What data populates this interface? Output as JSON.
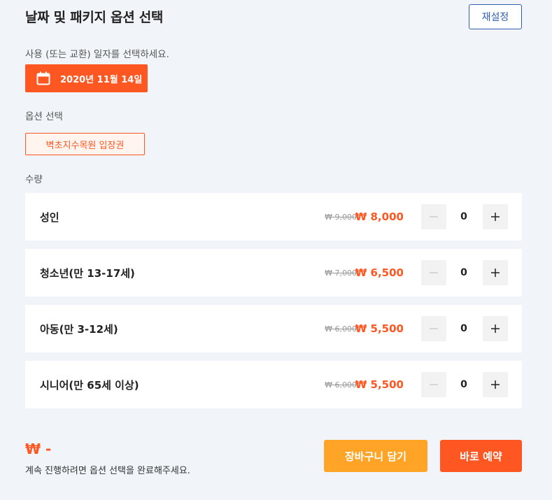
{
  "header": {
    "title": "날짜 및 패키지 옵션 선택",
    "reset_label": "재설정"
  },
  "date_section": {
    "label": "사용 (또는 교환) 일자를 선택하세요.",
    "selected_date": "2020년 11월 14일",
    "icon": "calendar-icon"
  },
  "option_section": {
    "label": "옵션 선택",
    "selected_option": "벽초지수목원 입장권"
  },
  "quantity_section": {
    "label": "수량",
    "rows": [
      {
        "label": "성인",
        "original_price": "₩ 9,000",
        "sale_price": "₩ 8,000",
        "count": "0"
      },
      {
        "label": "청소년(만 13-17세)",
        "original_price": "₩ 7,000",
        "sale_price": "₩ 6,500",
        "count": "0"
      },
      {
        "label": "아동(만 3-12세)",
        "original_price": "₩ 6,000",
        "sale_price": "₩ 5,500",
        "count": "0"
      },
      {
        "label": "시니어(만 65세 이상)",
        "original_price": "₩ 6,000",
        "sale_price": "₩ 5,500",
        "count": "0"
      }
    ]
  },
  "footer": {
    "total": "₩ -",
    "hint": "계속 진행하려면 옵션 선택을 완료해주세요.",
    "cart_label": "장바구니 담기",
    "book_label": "바로 예약"
  },
  "colors": {
    "accent": "#ff5722",
    "cart": "#ffa426",
    "reset_border": "#2f5fae",
    "background": "#f1f5f9"
  }
}
